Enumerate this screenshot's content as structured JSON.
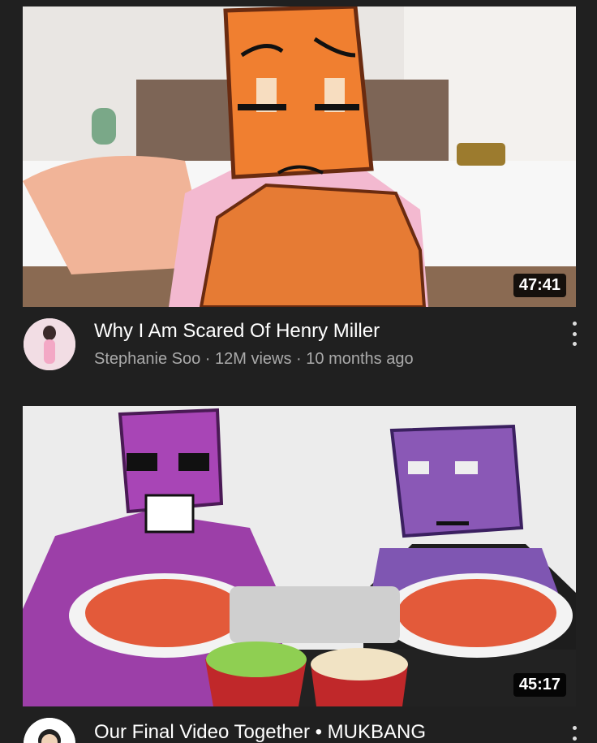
{
  "videos": [
    {
      "title": "Why I Am Scared Of Henry Miller",
      "channel": "Stephanie Soo",
      "views": "12M views",
      "age": "10 months ago",
      "duration": "47:41",
      "thumbnail": "bedroom scene with orange drawn character",
      "avatar": "channel-avatar"
    },
    {
      "title": "Our Final Video Together • MUKBANG",
      "duration": "45:17",
      "thumbnail": "mukbang scene with purple drawn characters",
      "avatar": "channel-avatar"
    }
  ],
  "separator": " · ",
  "icons": {
    "more": "kebab-menu-icon"
  }
}
